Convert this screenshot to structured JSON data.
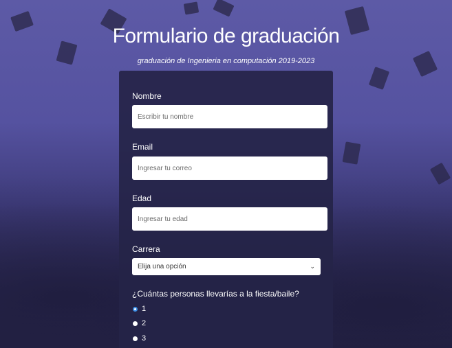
{
  "header": {
    "title": "Formulario de graduación",
    "subtitle": "graduación de Ingenieria en computación 2019-2023"
  },
  "form": {
    "name": {
      "label": "Nombre",
      "placeholder": "Escribir tu nombre"
    },
    "email": {
      "label": "Email",
      "placeholder": "Ingresar tu correo"
    },
    "age": {
      "label": "Edad",
      "placeholder": "Ingresar tu edad"
    },
    "career": {
      "label": "Carrera",
      "selected": "Elija una opción"
    },
    "guests": {
      "question": "¿Cuántas personas llevarías a la fiesta/baile?",
      "options": [
        "1",
        "2",
        "3"
      ],
      "selected_index": 0
    }
  },
  "colors": {
    "card_bg": "#252448",
    "radio_accent": "#3b8ee6"
  },
  "icons": {
    "select_chevron": "chevron-down-icon"
  }
}
